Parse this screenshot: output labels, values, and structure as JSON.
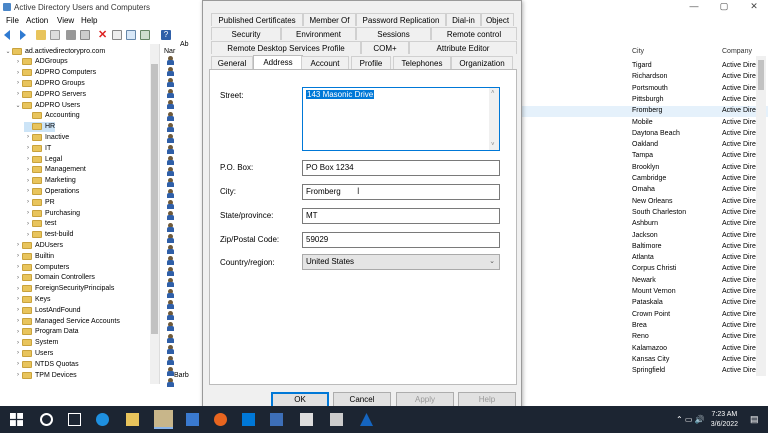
{
  "window": {
    "title": "Active Directory Users and Computers"
  },
  "menu": [
    "File",
    "Action",
    "View",
    "Help"
  ],
  "tree": [
    {
      "label": "ad.activedirectorypro.com",
      "level": 0,
      "arrow": "v"
    },
    {
      "label": "ADGroups",
      "level": 1,
      "arrow": ">"
    },
    {
      "label": "ADPRO Computers",
      "level": 1,
      "arrow": ">"
    },
    {
      "label": "ADPRO Groups",
      "level": 1,
      "arrow": ">"
    },
    {
      "label": "ADPRO Servers",
      "level": 1,
      "arrow": ">"
    },
    {
      "label": "ADPRO Users",
      "level": 1,
      "arrow": "v"
    },
    {
      "label": "Accounting",
      "level": 2,
      "arrow": ""
    },
    {
      "label": "HR",
      "level": 2,
      "arrow": "",
      "selected": true
    },
    {
      "label": "Inactive",
      "level": 2,
      "arrow": ">"
    },
    {
      "label": "IT",
      "level": 2,
      "arrow": ">"
    },
    {
      "label": "Legal",
      "level": 2,
      "arrow": ">"
    },
    {
      "label": "Management",
      "level": 2,
      "arrow": ">"
    },
    {
      "label": "Marketing",
      "level": 2,
      "arrow": ">"
    },
    {
      "label": "Operations",
      "level": 2,
      "arrow": ">"
    },
    {
      "label": "PR",
      "level": 2,
      "arrow": ">"
    },
    {
      "label": "Purchasing",
      "level": 2,
      "arrow": ">"
    },
    {
      "label": "test",
      "level": 2,
      "arrow": ">"
    },
    {
      "label": "test-build",
      "level": 2,
      "arrow": ">"
    },
    {
      "label": "ADUsers",
      "level": 1,
      "arrow": ">"
    },
    {
      "label": "Builtin",
      "level": 1,
      "arrow": ">"
    },
    {
      "label": "Computers",
      "level": 1,
      "arrow": ">"
    },
    {
      "label": "Domain Controllers",
      "level": 1,
      "arrow": ">"
    },
    {
      "label": "ForeignSecurityPrincipals",
      "level": 1,
      "arrow": ">"
    },
    {
      "label": "Keys",
      "level": 1,
      "arrow": ">"
    },
    {
      "label": "LostAndFound",
      "level": 1,
      "arrow": ">"
    },
    {
      "label": "Managed Service Accounts",
      "level": 1,
      "arrow": ">"
    },
    {
      "label": "Program Data",
      "level": 1,
      "arrow": ">"
    },
    {
      "label": "System",
      "level": 1,
      "arrow": ">"
    },
    {
      "label": "Users",
      "level": 1,
      "arrow": ">"
    },
    {
      "label": "NTDS Quotas",
      "level": 1,
      "arrow": ">"
    },
    {
      "label": "TPM Devices",
      "level": 1,
      "arrow": ">"
    }
  ],
  "middle": {
    "col_header": "Nar",
    "sub_header": "Ab",
    "bottom_label": "Barb"
  },
  "list": {
    "headers": {
      "city": "City",
      "company": "Company"
    },
    "rows": [
      {
        "city": "Tigard",
        "company": "Active Dire"
      },
      {
        "city": "Richardson",
        "company": "Active Dire"
      },
      {
        "city": "Portsmouth",
        "company": "Active Dire"
      },
      {
        "city": "Pittsburgh",
        "company": "Active Dire"
      },
      {
        "city": "Fromberg",
        "company": "Active Dire",
        "selected": true
      },
      {
        "city": "Mobile",
        "company": "Active Dire"
      },
      {
        "city": "Daytona Beach",
        "company": "Active Dire"
      },
      {
        "city": "Oakland",
        "company": "Active Dire"
      },
      {
        "city": "Tampa",
        "company": "Active Dire"
      },
      {
        "city": "Brooklyn",
        "company": "Active Dire"
      },
      {
        "city": "Cambridge",
        "company": "Active Dire"
      },
      {
        "city": "Omaha",
        "company": "Active Dire"
      },
      {
        "city": "New Orleans",
        "company": "Active Dire"
      },
      {
        "city": "South Charleston",
        "company": "Active Dire"
      },
      {
        "city": "Ashburn",
        "company": "Active Dire"
      },
      {
        "city": "Jackson",
        "company": "Active Dire"
      },
      {
        "city": "Baltimore",
        "company": "Active Dire"
      },
      {
        "city": "Atlanta",
        "company": "Active Dire"
      },
      {
        "city": "Corpus Christi",
        "company": "Active Dire"
      },
      {
        "city": "Newark",
        "company": "Active Dire"
      },
      {
        "city": "Mount Vernon",
        "company": "Active Dire"
      },
      {
        "city": "Pataskala",
        "company": "Active Dire"
      },
      {
        "city": "Crown Point",
        "company": "Active Dire"
      },
      {
        "city": "Brea",
        "company": "Active Dire"
      },
      {
        "city": "Reno",
        "company": "Active Dire"
      },
      {
        "city": "Kalamazoo",
        "company": "Active Dire"
      },
      {
        "city": "Kansas City",
        "company": "Active Dire"
      },
      {
        "city": "Springfield",
        "company": "Active Dire"
      }
    ]
  },
  "dialog": {
    "tabs_row1": [
      "Published Certificates",
      "Member Of",
      "Password Replication",
      "Dial-in",
      "Object"
    ],
    "tabs_row2": [
      "Security",
      "Environment",
      "Sessions",
      "Remote control"
    ],
    "tabs_row3": [
      "Remote Desktop Services Profile",
      "COM+",
      "Attribute Editor"
    ],
    "tabs_row4": [
      "General",
      "Address",
      "Account",
      "Profile",
      "Telephones",
      "Organization"
    ],
    "active_tab": "Address",
    "fields": {
      "street_label": "Street:",
      "street_value": "143 Masonic Drive",
      "pobox_label": "P.O. Box:",
      "pobox_value": "PO Box 1234",
      "city_label": "City:",
      "city_value": "Fromberg",
      "state_label": "State/province:",
      "state_value": "MT",
      "zip_label": "Zip/Postal Code:",
      "zip_value": "59029",
      "country_label": "Country/region:",
      "country_value": "United States"
    },
    "buttons": {
      "ok": "OK",
      "cancel": "Cancel",
      "apply": "Apply",
      "help": "Help"
    }
  },
  "taskbar": {
    "time": "7:23 AM",
    "date": "3/6/2022"
  }
}
